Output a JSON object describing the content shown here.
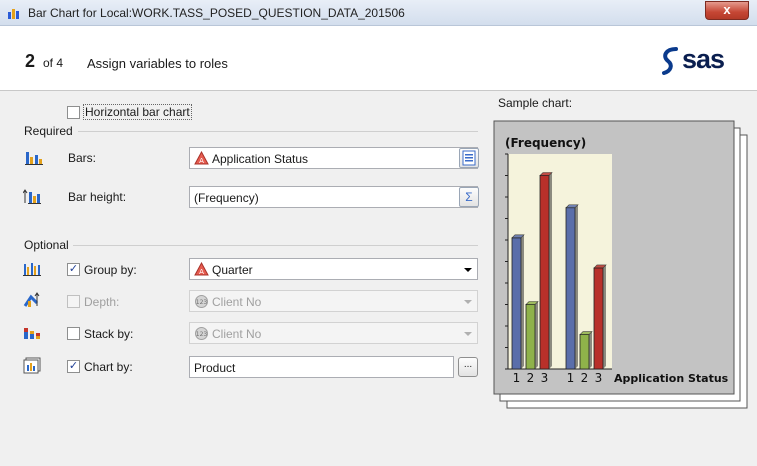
{
  "window": {
    "title": "Bar Chart for Local:WORK.TASS_POSED_QUESTION_DATA_201506",
    "close_label": "x"
  },
  "header": {
    "step_number": "2",
    "step_of": "of 4",
    "step_title": "Assign variables to roles",
    "logo_text": "sas"
  },
  "options": {
    "horizontal_label": "Horizontal bar chart",
    "horizontal_checked": false
  },
  "sections": {
    "required": "Required",
    "optional": "Optional"
  },
  "roles": {
    "bars": {
      "label": "Bars:",
      "value": "Application Status",
      "icon": "bar-chart-role-icon",
      "var_icon": "character-variable-icon"
    },
    "bar_height": {
      "label": "Bar height:",
      "value": "(Frequency)",
      "icon": "bar-height-role-icon",
      "sum_label": "Σ"
    },
    "group_by": {
      "label": "Group by:",
      "value": "Quarter",
      "checked": true,
      "var_icon": "character-variable-icon"
    },
    "depth": {
      "label": "Depth:",
      "value": "Client No",
      "checked": false,
      "var_icon": "numeric-variable-icon"
    },
    "stack_by": {
      "label": "Stack by:",
      "value": "Client No",
      "checked": false,
      "var_icon": "numeric-variable-icon"
    },
    "chart_by": {
      "label": "Chart by:",
      "value": "Product",
      "checked": true,
      "browse_label": "..."
    }
  },
  "sample": {
    "label": "Sample chart:"
  },
  "chart_data": {
    "type": "bar",
    "title": "(Frequency)",
    "xlabel": "Application Status",
    "groups": [
      "",
      ""
    ],
    "categories": [
      "1",
      "2",
      "3"
    ],
    "series": [
      {
        "values": [
          61,
          30,
          90
        ]
      },
      {
        "values": [
          75,
          16,
          47
        ]
      }
    ],
    "colors": [
      "#5a6eaa",
      "#8fb24a",
      "#b8302a"
    ],
    "ylim": [
      0,
      100
    ]
  }
}
